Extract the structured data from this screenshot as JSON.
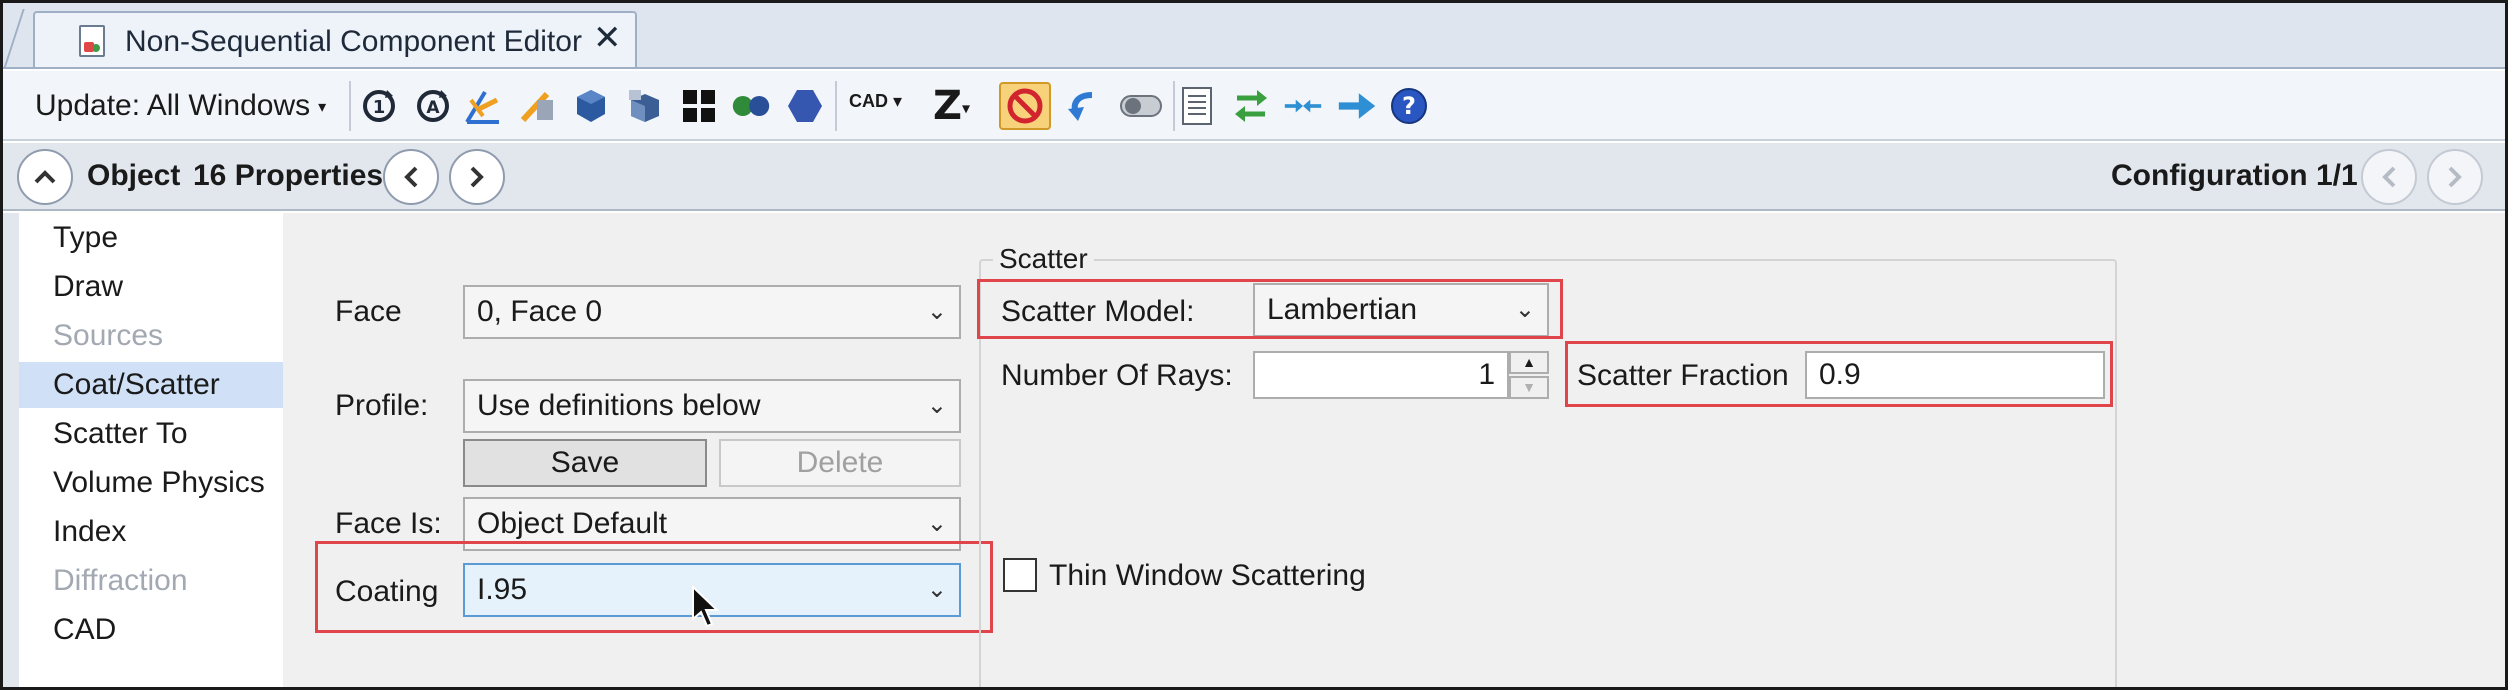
{
  "tab": {
    "title": "Non-Sequential Component Editor",
    "close_glyph": "✕",
    "icon": "nsc-editor-document-icon"
  },
  "toolbar": {
    "update_label": "Update: All Windows",
    "update_caret": "▾",
    "cad_label": "CAD",
    "z_label": "Z",
    "caret": "▾",
    "icons": [
      "update-1-icon",
      "update-all-icon",
      "ray-trace-icon",
      "layout-icon",
      "solid-3d-icon",
      "shaded-model-icon",
      "grid-icon",
      "pair-circles-icon",
      "hexagon-icon",
      "no-entry-icon",
      "undo-arrow-icon",
      "toggle-icon",
      "document-icon",
      "swap-arrows-icon",
      "merge-arrows-icon",
      "right-arrow-icon",
      "help-icon"
    ]
  },
  "object_bar": {
    "collapse_glyph": "^",
    "label": "Object",
    "count": "16 Properties",
    "prev_glyph": "<",
    "next_glyph": ">",
    "configuration": "Configuration 1/1"
  },
  "nav": {
    "items": [
      {
        "label": "Type",
        "state": "normal"
      },
      {
        "label": "Draw",
        "state": "normal"
      },
      {
        "label": "Sources",
        "state": "disabled"
      },
      {
        "label": "Coat/Scatter",
        "state": "selected"
      },
      {
        "label": "Scatter To",
        "state": "normal"
      },
      {
        "label": "Volume Physics",
        "state": "normal"
      },
      {
        "label": "Index",
        "state": "normal"
      },
      {
        "label": "Diffraction",
        "state": "disabled"
      },
      {
        "label": "CAD",
        "state": "normal"
      }
    ]
  },
  "coat": {
    "face_label": "Face",
    "face_value": "0, Face 0",
    "profile_label": "Profile:",
    "profile_value": "Use definitions below",
    "save_label": "Save",
    "delete_label": "Delete",
    "face_is_label": "Face Is:",
    "face_is_value": "Object Default",
    "coating_label": "Coating",
    "coating_value": "I.95",
    "chevron": "⌄"
  },
  "scatter": {
    "group_title": "Scatter",
    "model_label": "Scatter Model:",
    "model_value": "Lambertian",
    "rays_label": "Number Of Rays:",
    "rays_value": "1",
    "spin_up": "▲",
    "spin_down": "▼",
    "fraction_label": "Scatter Fraction",
    "fraction_value": "0.9",
    "thin_window_label": "Thin Window Scattering",
    "thin_window_checked": false
  },
  "colors": {
    "highlight": "#e0454b",
    "selected_nav": "#cfe0f7",
    "active_toolbar": "#f8d27a"
  }
}
